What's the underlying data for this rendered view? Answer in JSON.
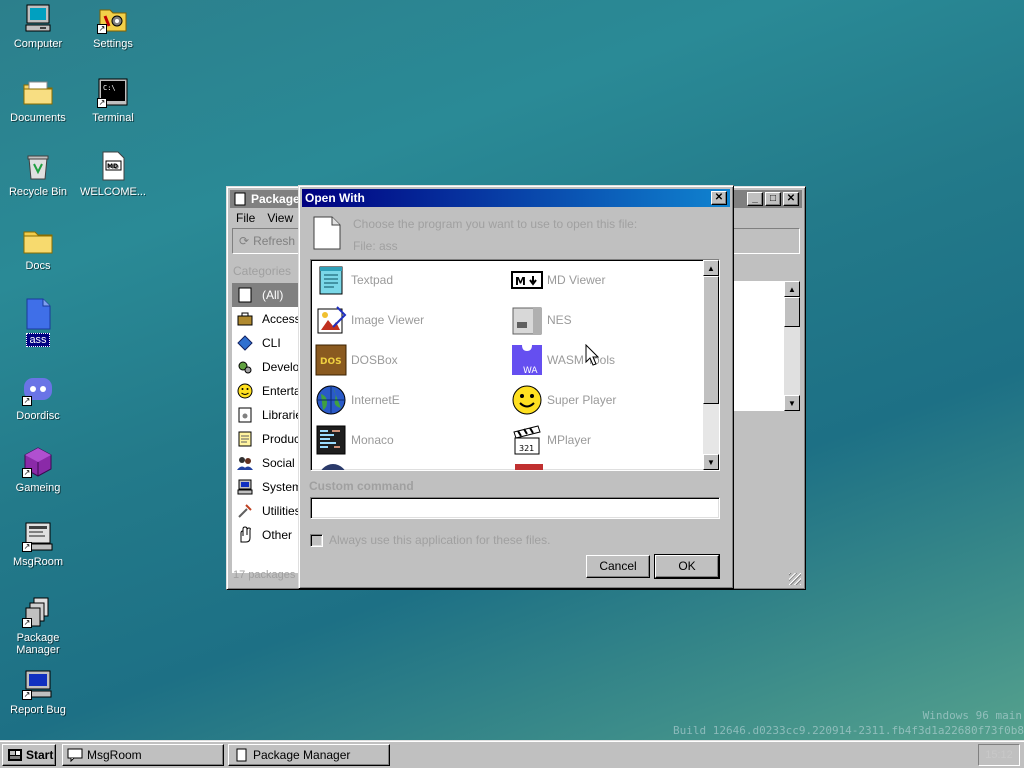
{
  "desktop": {
    "icons": [
      {
        "label": "Computer"
      },
      {
        "label": "Settings"
      },
      {
        "label": "Documents"
      },
      {
        "label": "Terminal"
      },
      {
        "label": "Recycle Bin"
      },
      {
        "label": "WELCOME...",
        "badge": "MD"
      },
      {
        "label": "Docs"
      },
      {
        "label": "ass"
      },
      {
        "label": "Doordisc"
      },
      {
        "label": "Gameing"
      },
      {
        "label": "MsgRoom"
      },
      {
        "label": "Package Manager"
      },
      {
        "label": "Report Bug"
      }
    ],
    "build_line1": "Windows 96 main",
    "build_line2": "Build 12646.d0233cc9.220914-2311.fb4f3d1a22680f73f0b8"
  },
  "package_manager": {
    "title": "Package Manager",
    "menu": [
      "File",
      "View"
    ],
    "toolbar": {
      "refresh": "Refresh"
    },
    "categories_header": "Categories",
    "categories": [
      "(All)",
      "Access",
      "CLI",
      "Develo",
      "Enterta",
      "Librarie",
      "Produc",
      "Social",
      "System",
      "Utilities",
      "Other"
    ],
    "status": "17 packages l"
  },
  "open_with": {
    "title": "Open With",
    "prompt": "Choose the program you want to use to open this file:",
    "file_label": "File: ass",
    "apps": [
      {
        "name": "Textpad",
        "icon": "textpad-icon"
      },
      {
        "name": "MD Viewer",
        "icon": "md-viewer-icon",
        "badge": "M"
      },
      {
        "name": "Image Viewer",
        "icon": "image-viewer-icon"
      },
      {
        "name": "NES",
        "icon": "nes-icon"
      },
      {
        "name": "DOSBox",
        "icon": "dosbox-icon",
        "badge": "DOS"
      },
      {
        "name": "WASM Tools",
        "icon": "wasm-icon",
        "badge": "WA"
      },
      {
        "name": "InternetE",
        "icon": "globe-icon"
      },
      {
        "name": "Super Player",
        "icon": "smiley-icon"
      },
      {
        "name": "Monaco",
        "icon": "monaco-icon"
      },
      {
        "name": "MPlayer",
        "icon": "clapper-icon",
        "badge": "321"
      }
    ],
    "custom_command_label": "Custom command",
    "custom_command_value": "",
    "always_use_label": "Always use this application for these files.",
    "always_use_checked": false,
    "cancel_label": "Cancel",
    "ok_label": "OK"
  },
  "taskbar": {
    "start_label": "Start",
    "tasks": [
      {
        "label": "MsgRoom"
      },
      {
        "label": "Package Manager"
      }
    ],
    "clock": "15:12"
  },
  "colors": {
    "active_title_start": "#000080",
    "active_title_end": "#1084d0",
    "inactive_title": "#808080",
    "face": "#c0c0c0"
  }
}
